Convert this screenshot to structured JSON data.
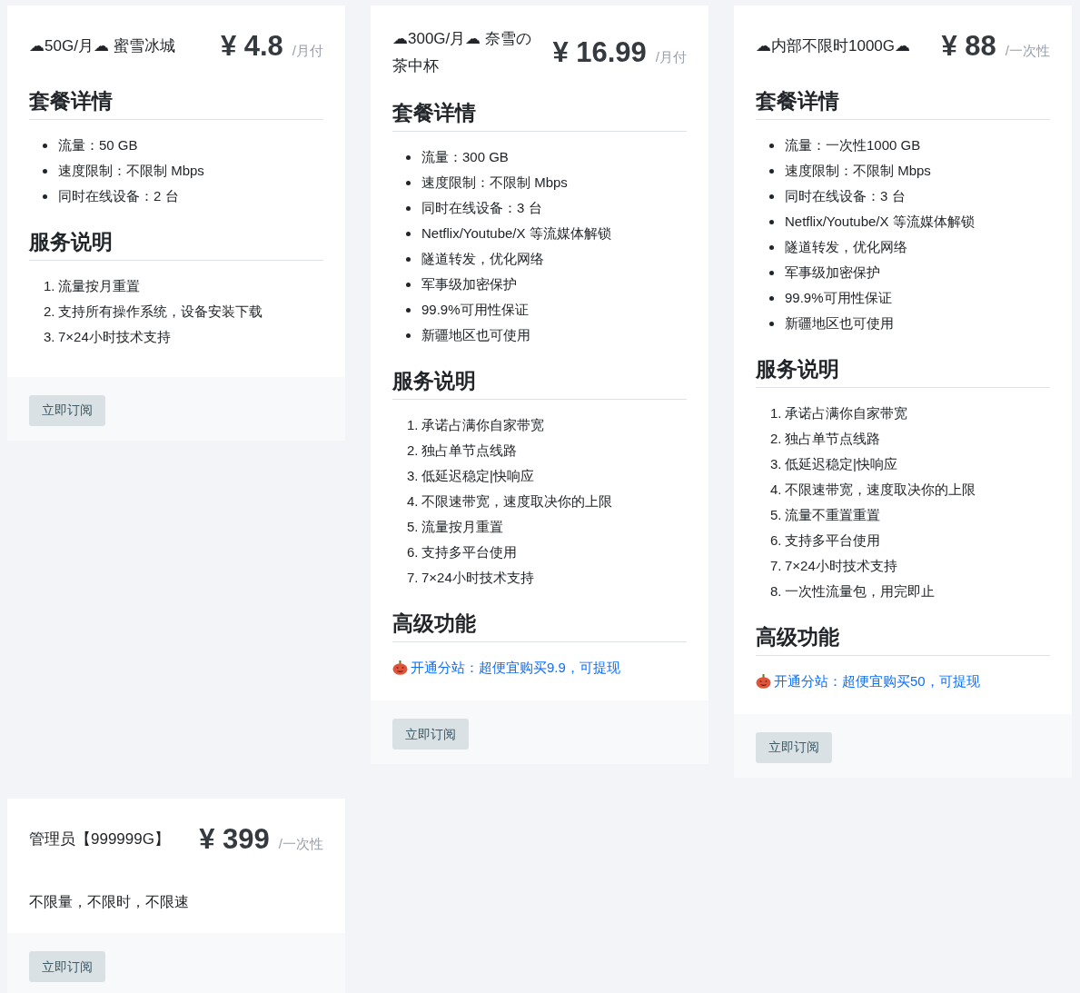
{
  "plans": [
    {
      "title": "☁50G/月☁ 蜜雪冰城",
      "price": "¥ 4.8",
      "unit": "/月付",
      "sections": [
        {
          "kind": "bullets",
          "heading": "套餐详情",
          "items": [
            "流量：50 GB",
            "速度限制：不限制 Mbps",
            "同时在线设备：2 台"
          ]
        },
        {
          "kind": "numbered",
          "heading": "服务说明",
          "items": [
            {
              "number": "1.",
              "text": "流量按月重置"
            },
            {
              "number": "2.",
              "text": "支持所有操作系统，设备安装下载"
            },
            {
              "number": "3.",
              "text": "7×24小时技术支持"
            }
          ]
        }
      ],
      "button": "立即订阅"
    },
    {
      "title": "☁300G/月☁ 奈雪の茶中杯",
      "price": "¥ 16.99",
      "unit": "/月付",
      "sections": [
        {
          "kind": "bullets",
          "heading": "套餐详情",
          "items": [
            "流量：300 GB",
            "速度限制：不限制 Mbps",
            "同时在线设备：3 台",
            "Netflix/Youtube/X 等流媒体解锁",
            "隧道转发，优化网络",
            "军事级加密保护",
            "99.9%可用性保证",
            "新疆地区也可使用"
          ]
        },
        {
          "kind": "numbered",
          "heading": "服务说明",
          "items": [
            {
              "number": "1.",
              "text": "承诺占满你自家带宽"
            },
            {
              "number": "2.",
              "text": "独占单节点线路"
            },
            {
              "number": "3.",
              "text": "低延迟稳定|快响应"
            },
            {
              "number": "4.",
              "text": "不限速带宽，速度取决你的上限"
            },
            {
              "number": "5.",
              "text": "流量按月重置"
            },
            {
              "number": "6.",
              "text": "支持多平台使用"
            },
            {
              "number": "7.",
              "text": "7×24小时技术支持"
            }
          ]
        },
        {
          "kind": "links",
          "heading": "高级功能",
          "items": [
            "开通分站：超便宜购买9.9，可提现"
          ]
        }
      ],
      "button": "立即订阅"
    },
    {
      "title": "☁内部不限时1000G☁",
      "price": "¥ 88",
      "unit": "/一次性",
      "sections": [
        {
          "kind": "bullets",
          "heading": "套餐详情",
          "items": [
            "流量：一次性1000 GB",
            "速度限制：不限制 Mbps",
            "同时在线设备：3 台",
            "Netflix/Youtube/X 等流媒体解锁",
            "隧道转发，优化网络",
            "军事级加密保护",
            "99.9%可用性保证",
            "新疆地区也可使用"
          ]
        },
        {
          "kind": "numbered",
          "heading": "服务说明",
          "items": [
            {
              "number": "1.",
              "text": "承诺占满你自家带宽"
            },
            {
              "number": "2.",
              "text": "独占单节点线路"
            },
            {
              "number": "3.",
              "text": "低延迟稳定|快响应"
            },
            {
              "number": "4.",
              "text": "不限速带宽，速度取决你的上限"
            },
            {
              "number": "5.",
              "text": "流量不重置重置"
            },
            {
              "number": "6.",
              "text": "支持多平台使用"
            },
            {
              "number": "7.",
              "text": "7×24小时技术支持"
            },
            {
              "number": "8.",
              "text": "一次性流量包，用完即止"
            }
          ]
        },
        {
          "kind": "links",
          "heading": "高级功能",
          "items": [
            "开通分站：超便宜购买50，可提现"
          ]
        }
      ],
      "button": "立即订阅"
    },
    {
      "title": "管理员【999999G】",
      "price": "¥ 399",
      "unit": "/一次性",
      "sections": [
        {
          "kind": "text",
          "items": [
            "不限量，不限时，不限速"
          ]
        }
      ],
      "button": "立即订阅"
    }
  ]
}
